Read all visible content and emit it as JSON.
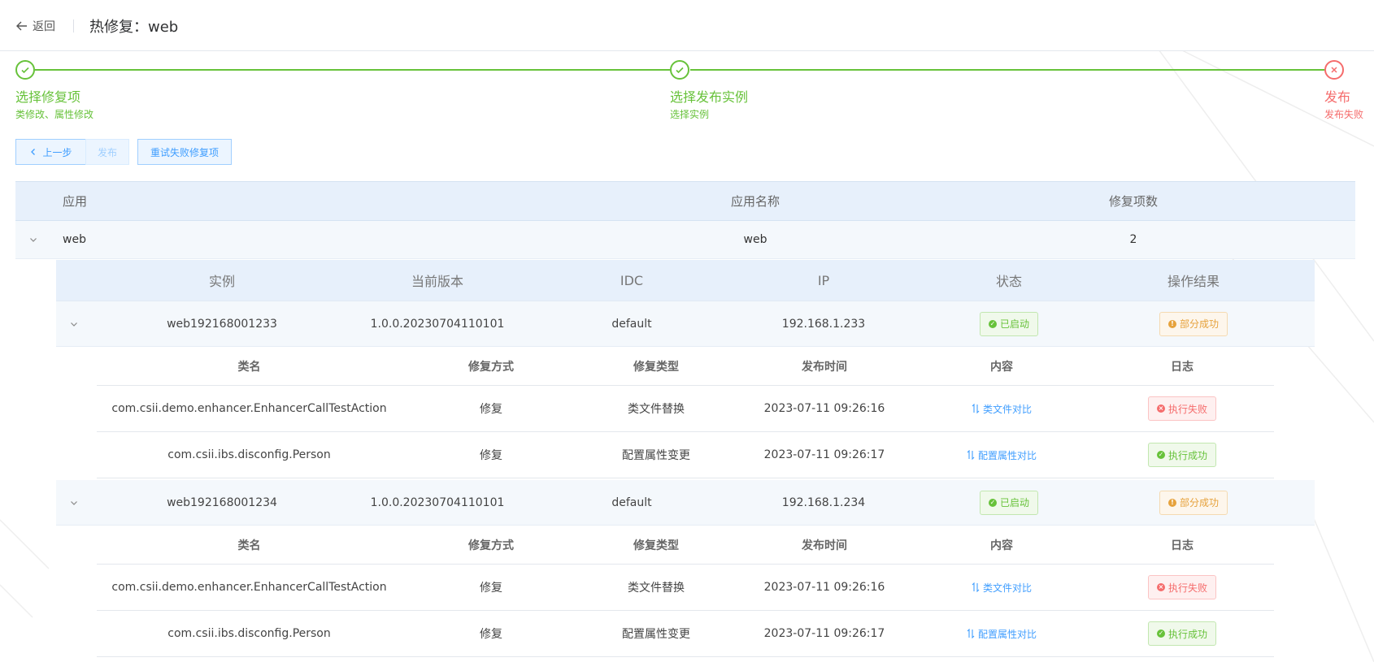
{
  "header": {
    "back_label": "返回",
    "title": "热修复：web"
  },
  "steps": [
    {
      "title": "选择修复项",
      "desc": "类修改、属性修改",
      "status": "success"
    },
    {
      "title": "选择发布实例",
      "desc": "选择实例",
      "status": "success"
    },
    {
      "title": "发布",
      "desc": "发布失败",
      "status": "error"
    }
  ],
  "toolbar": {
    "prev_label": "上一步",
    "publish_label": "发布",
    "retry_label": "重试失败修复项"
  },
  "app_table": {
    "columns": [
      "应用",
      "应用名称",
      "修复项数"
    ],
    "row": {
      "app": "web",
      "app_name": "web",
      "fix_count": "2"
    }
  },
  "instance_table": {
    "columns": [
      "实例",
      "当前版本",
      "IDC",
      "IP",
      "状态",
      "操作结果"
    ],
    "detail_columns": [
      "类名",
      "修复方式",
      "修复类型",
      "发布时间",
      "内容",
      "日志"
    ],
    "instances": [
      {
        "name": "web192168001233",
        "version": "1.0.0.20230704110101",
        "idc": "default",
        "ip": "192.168.1.233",
        "status": "已启动",
        "result": "部分成功",
        "details": [
          {
            "class_name": "com.csii.demo.enhancer.EnhancerCallTestAction",
            "method": "修复",
            "type": "类文件替换",
            "time": "2023-07-11 09:26:16",
            "content": "类文件对比",
            "log": "执行失败",
            "log_status": "danger"
          },
          {
            "class_name": "com.csii.ibs.disconfig.Person",
            "method": "修复",
            "type": "配置属性变更",
            "time": "2023-07-11 09:26:17",
            "content": "配置属性对比",
            "log": "执行成功",
            "log_status": "success"
          }
        ]
      },
      {
        "name": "web192168001234",
        "version": "1.0.0.20230704110101",
        "idc": "default",
        "ip": "192.168.1.234",
        "status": "已启动",
        "result": "部分成功",
        "details": [
          {
            "class_name": "com.csii.demo.enhancer.EnhancerCallTestAction",
            "method": "修复",
            "type": "类文件替换",
            "time": "2023-07-11 09:26:16",
            "content": "类文件对比",
            "log": "执行失败",
            "log_status": "danger"
          },
          {
            "class_name": "com.csii.ibs.disconfig.Person",
            "method": "修复",
            "type": "配置属性变更",
            "time": "2023-07-11 09:26:17",
            "content": "配置属性对比",
            "log": "执行成功",
            "log_status": "success"
          }
        ]
      }
    ]
  },
  "colors": {
    "success": "#67c23a",
    "error": "#f56c6c",
    "warning": "#e6a23c",
    "primary": "#409eff"
  }
}
